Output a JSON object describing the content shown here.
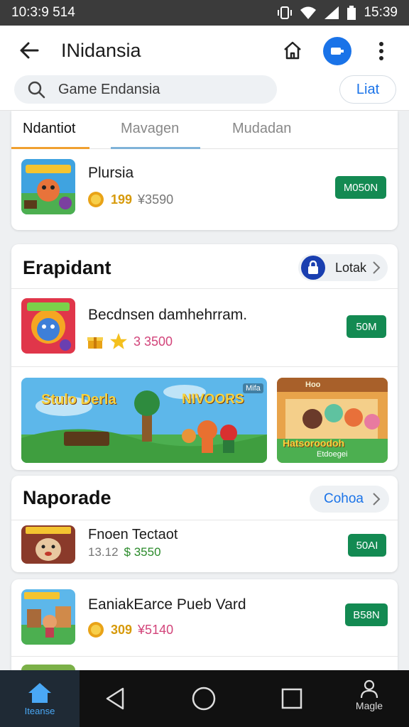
{
  "status_bar": {
    "time": "10:3:9 514",
    "clock_right": "15:39",
    "icons": [
      "vibrate-icon",
      "wifi-icon",
      "signal-icon",
      "battery-icon"
    ]
  },
  "header": {
    "title": "INidansia",
    "search_placeholder": "Game Endansia",
    "liat_label": "Liat"
  },
  "tabs": [
    {
      "label": "Ndantiot",
      "active": true
    },
    {
      "label": "Mavagen",
      "active": false
    },
    {
      "label": "Mudadan",
      "active": false
    }
  ],
  "top_item": {
    "title": "Plursia",
    "rating": "199",
    "price": "¥3590",
    "button": "M050N"
  },
  "section_1": {
    "title": "Erapidant",
    "action_label": "Lotak",
    "item": {
      "title": "Becdnsen damhehrram.",
      "price": "3 3500",
      "button": "50M"
    },
    "banners": [
      {
        "title": "Stulo Derla",
        "subtitle": "NIVOORS",
        "tag": "Mifa"
      },
      {
        "title": "Hatsoroodoh",
        "subtitle": "Etdoegei",
        "tag": "Hoo"
      }
    ]
  },
  "section_2": {
    "title": "Naporade",
    "action_label": "Cohoa",
    "items": [
      {
        "title": "Fnoen Tectaot",
        "meta_num": "13.12",
        "price": "$ 3550",
        "button": "50AI"
      },
      {
        "title": "EaniakEarce Pueb Vard",
        "rating": "309",
        "price": "¥5140",
        "button": "B58N"
      }
    ]
  },
  "bottom_nav": {
    "home_label": "Iteanse",
    "profile_label": "Magle"
  },
  "colors": {
    "accent_blue": "#1a73e8",
    "buy_green": "#138a52",
    "tab_orange": "#f0a030",
    "tab_blue": "#7fb3d8"
  }
}
